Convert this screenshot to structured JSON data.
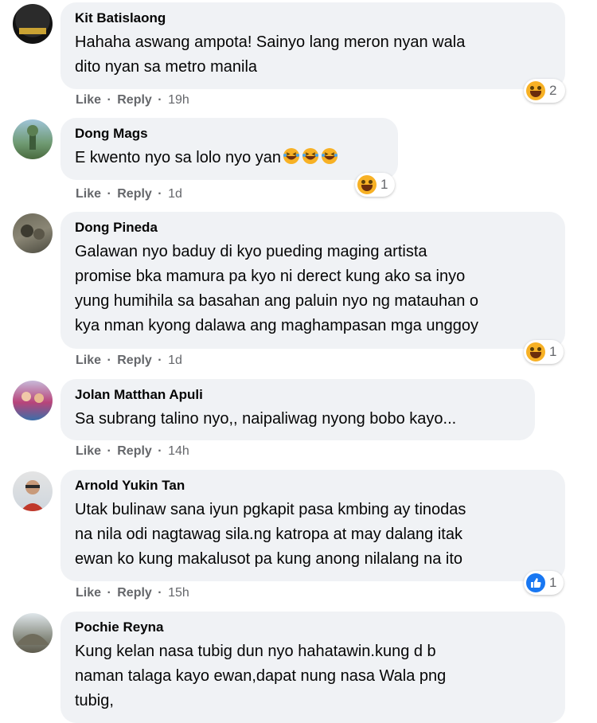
{
  "actions": {
    "like": "Like",
    "reply": "Reply",
    "sep": "·"
  },
  "colors": {
    "bubble": "#f0f2f5",
    "haha": "#f7b125",
    "like": "#1877f2",
    "meta": "#65676b"
  },
  "comments": [
    {
      "author": "Kit Batislaong",
      "text": "Hahaha aswang ampota! Sainyo lang meron nyan wala\ndito nyan sa metro manila",
      "time": "19h",
      "reaction": {
        "icon": "haha-emoji",
        "count": "2"
      }
    },
    {
      "author": "Dong Mags",
      "text": "E kwento nyo sa lolo nyo yan",
      "inline_emojis": [
        "laughing-emoji",
        "laughing-emoji",
        "laughing-emoji"
      ],
      "time": "1d",
      "reaction": {
        "icon": "haha-emoji",
        "count": "1"
      }
    },
    {
      "author": "Dong Pineda",
      "text": "Galawan nyo baduy di kyo pueding maging artista\npromise bka mamura pa kyo ni derect kung ako sa inyo\nyung humihila sa basahan ang paluin nyo ng matauhan o\nkya nman kyong dalawa ang maghampasan mga unggoy",
      "time": "1d",
      "reaction": {
        "icon": "haha-emoji",
        "count": "1"
      }
    },
    {
      "author": "Jolan Matthan Apuli",
      "text": "Sa subrang talino nyo,, naipaliwag nyong bobo kayo...",
      "time": "14h"
    },
    {
      "author": "Arnold Yukin Tan",
      "text": "Utak bulinaw sana iyun pgkapit pasa kmbing ay tinodas\nna nila odi nagtawag sila.ng katropa at may dalang itak\newan ko kung makalusot pa kung anong nilalang na ito",
      "time": "15h",
      "reaction": {
        "icon": "like-thumb-icon",
        "count": "1"
      }
    },
    {
      "author": "Pochie Reyna",
      "text": "Kung kelan nasa tubig dun nyo hahatawin.kung d b\nnaman talaga kayo ewan,dapat nung nasa Wala png\ntubig,"
    }
  ]
}
